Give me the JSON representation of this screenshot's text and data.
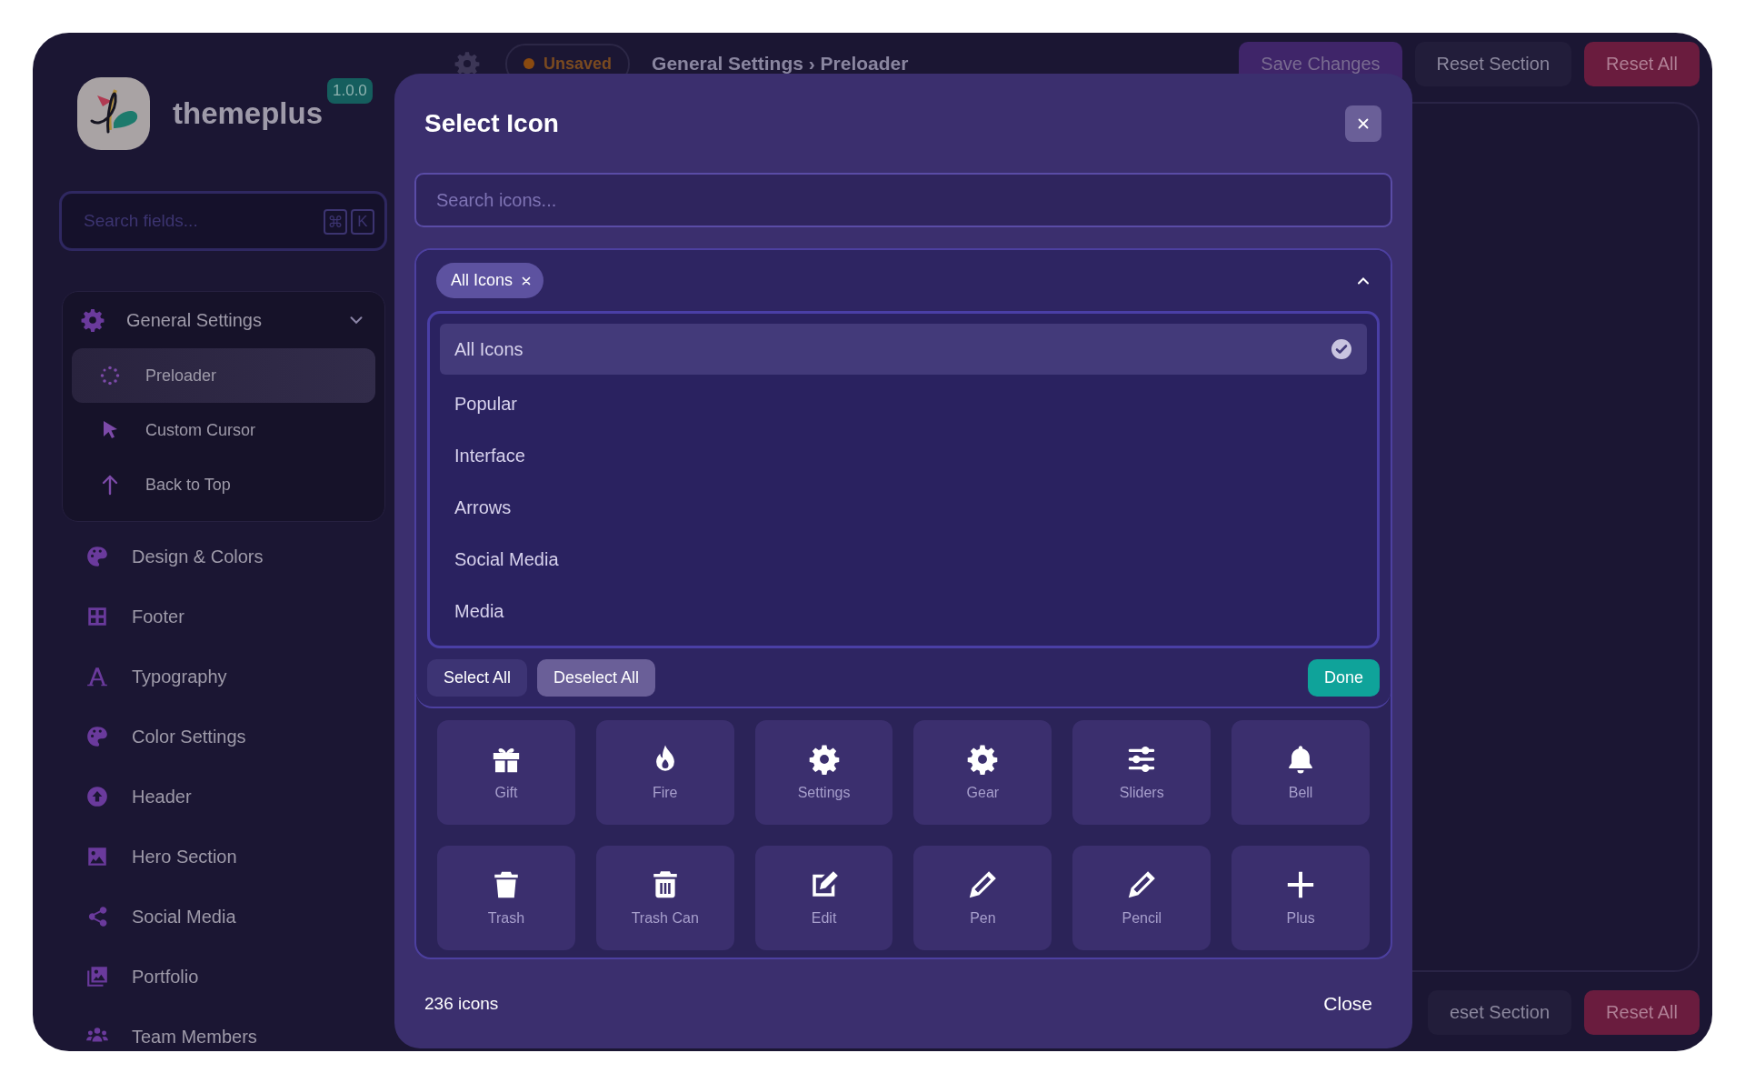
{
  "app": {
    "name": "themeplus",
    "version": "1.0.0"
  },
  "sidebar": {
    "search": {
      "placeholder": "Search fields...",
      "shortcut_keys": [
        "⌘",
        "K"
      ]
    },
    "groups": [
      {
        "label": "General Settings",
        "expanded": true,
        "children": [
          {
            "label": "Preloader",
            "selected": true
          },
          {
            "label": "Custom Cursor",
            "selected": false
          },
          {
            "label": "Back to Top",
            "selected": false
          }
        ]
      }
    ],
    "items": [
      {
        "label": "Design & Colors",
        "selected": false
      },
      {
        "label": "Footer",
        "selected": false
      },
      {
        "label": "Typography",
        "selected": false
      },
      {
        "label": "Color Settings",
        "selected": false
      },
      {
        "label": "Header",
        "selected": false
      },
      {
        "label": "Hero Section",
        "selected": false
      },
      {
        "label": "Social Media",
        "selected": false
      },
      {
        "label": "Portfolio",
        "selected": false
      },
      {
        "label": "Team Members",
        "selected": false
      }
    ]
  },
  "top_bar": {
    "status": "Unsaved",
    "breadcrumb": "General Settings › Preloader",
    "buttons": [
      {
        "label": "Save Changes",
        "kind": "primary"
      },
      {
        "label": "Reset Section",
        "kind": "secondary"
      },
      {
        "label": "Reset All",
        "kind": "danger"
      }
    ]
  },
  "bottom_bar": {
    "buttons": [
      {
        "label": "eset Section",
        "kind": "secondary"
      },
      {
        "label": "Reset All",
        "kind": "danger"
      }
    ]
  },
  "modal": {
    "title": "Select Icon",
    "search": {
      "placeholder": "Search icons..."
    },
    "filter": {
      "chips": [
        {
          "label": "All Icons"
        }
      ],
      "expanded": true,
      "options": [
        {
          "label": "All Icons",
          "selected": true
        },
        {
          "label": "Popular",
          "selected": false
        },
        {
          "label": "Interface",
          "selected": false
        },
        {
          "label": "Arrows",
          "selected": false
        },
        {
          "label": "Social Media",
          "selected": false
        },
        {
          "label": "Media",
          "selected": false
        }
      ],
      "actions": [
        {
          "label": "Select All",
          "kind": "plain"
        },
        {
          "label": "Deselect All",
          "kind": "muted"
        },
        {
          "label": "Done",
          "kind": "confirm"
        }
      ]
    },
    "icons": [
      {
        "label": "Gift"
      },
      {
        "label": "Fire"
      },
      {
        "label": "Settings"
      },
      {
        "label": "Gear"
      },
      {
        "label": "Sliders"
      },
      {
        "label": "Bell"
      },
      {
        "label": "Trash"
      },
      {
        "label": "Trash Can"
      },
      {
        "label": "Edit"
      },
      {
        "label": "Pen"
      },
      {
        "label": "Pencil"
      },
      {
        "label": "Plus"
      }
    ],
    "count": "236 icons",
    "close_label": "Close"
  }
}
